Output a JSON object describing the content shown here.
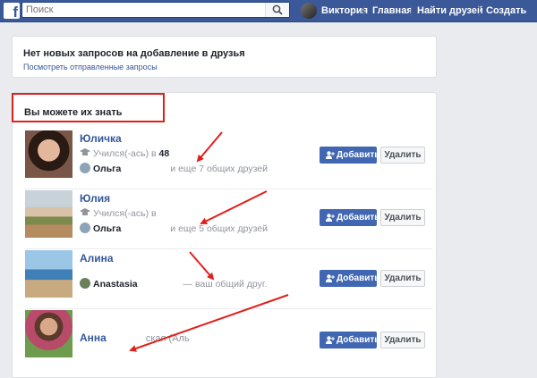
{
  "topbar": {
    "logo_letter": "f",
    "search_placeholder": "Поиск",
    "user_name": "Виктория",
    "nav": [
      "Главная",
      "Найти друзей",
      "Создать"
    ]
  },
  "requests": {
    "title": "Нет новых запросов на добавление в друзья",
    "link": "Посмотреть отправленные запросы"
  },
  "people": {
    "title": "Вы можете их знать",
    "add_label": "Добавить",
    "delete_label": "Удалить",
    "items": [
      {
        "name": "Юличка",
        "school": "Учился(-ась) в",
        "school_num": "48",
        "mutual_friend": "Ольга",
        "mutual_text": "и еще 7 общих друзей"
      },
      {
        "name": "Юлия",
        "school": "Учился(-ась) в",
        "mutual_friend": "Ольга",
        "mutual_text": "и еще 5 общих друзей"
      },
      {
        "name": "Алина",
        "mutual_friend": "Anastasia",
        "mutual_text": "— ваш общий друг."
      },
      {
        "name": "Анна",
        "name_tail": "ская (Аль"
      }
    ]
  },
  "colors": {
    "brand": "#3b5998",
    "link": "#365899",
    "button": "#4267b2",
    "highlight": "#e0201b"
  }
}
